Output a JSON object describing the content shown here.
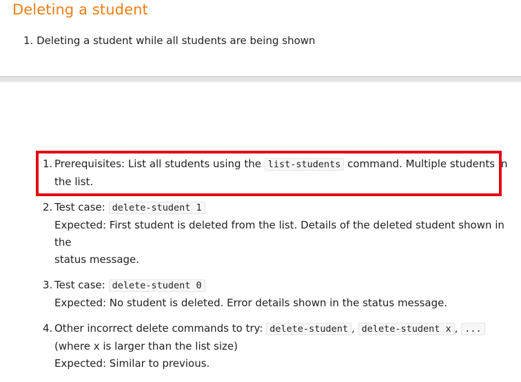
{
  "heading": "Deleting a student",
  "intro": {
    "number": "1.",
    "text": "Deleting a student while all students are being shown"
  },
  "steps": [
    {
      "number": "1.",
      "pre": "Prerequisites: List all students using the ",
      "code": "list-students",
      "post": " command. Multiple students in",
      "line2": "the list."
    },
    {
      "number": "2.",
      "label": "Test case: ",
      "code": "delete-student 1",
      "expected": "Expected: First student is deleted from the list. Details of the deleted student shown in the",
      "expected2": "status message."
    },
    {
      "number": "3.",
      "label": "Test case: ",
      "code": "delete-student 0",
      "expected": "Expected: No student is deleted. Error details shown in the status message."
    },
    {
      "number": "4.",
      "label": "Other incorrect delete commands to try: ",
      "code1": "delete-student",
      "sep1": ", ",
      "code2": "delete-student x",
      "sep2": ", ",
      "code3": "...",
      "line2": "(where x is larger than the list size)",
      "expected": "Expected: Similar to previous."
    }
  ],
  "colors": {
    "heading": "#ef7d15",
    "highlight": "#e30613"
  }
}
